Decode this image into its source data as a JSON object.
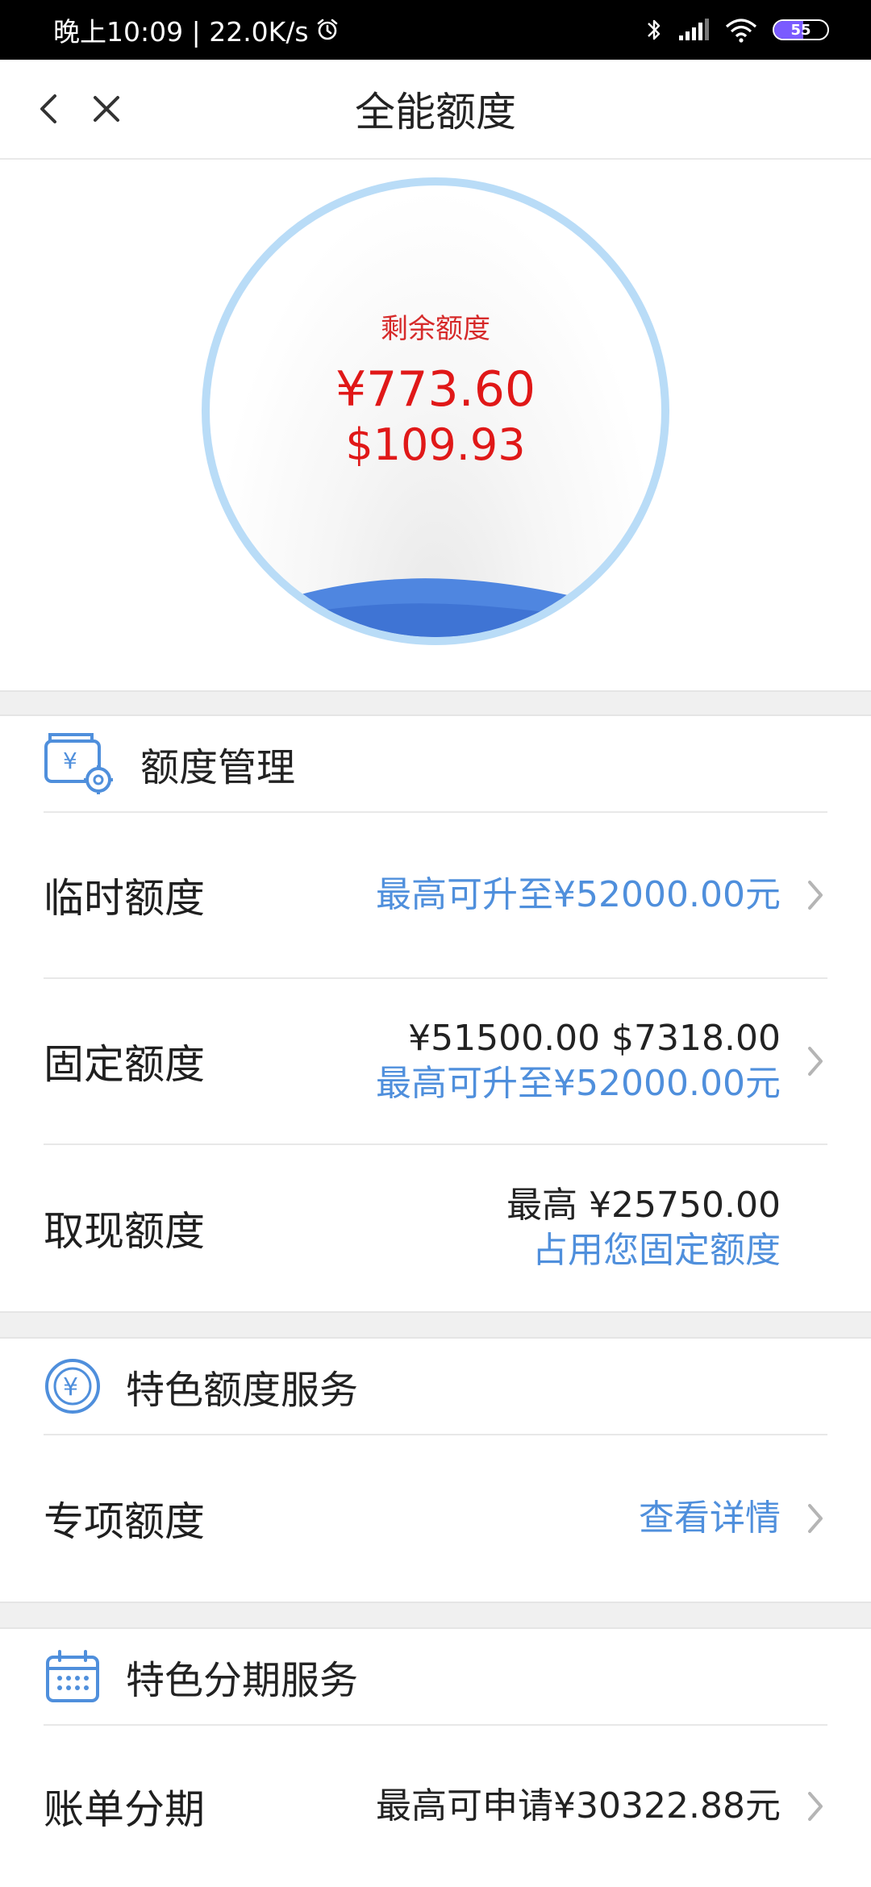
{
  "status_bar": {
    "time_speed": "晚上10:09 | 22.0K/s",
    "battery_percent": "55",
    "battery_level": 0.55,
    "icons": [
      "alarm-icon",
      "bluetooth-icon",
      "signal-icon",
      "wifi-icon",
      "battery-icon"
    ]
  },
  "header": {
    "title": "全能额度",
    "back_icon": "back-chevron-icon",
    "close_icon": "close-icon"
  },
  "hero": {
    "label": "剩余额度",
    "amount_cny": "¥773.60",
    "amount_usd": "$109.93"
  },
  "limit_management": {
    "title": "额度管理",
    "icon": "wallet-yen-gear-icon",
    "rows": [
      {
        "label": "临时额度",
        "value_blue": "最高可升至¥52000.00元",
        "has_arrow": true
      },
      {
        "label": "固定额度",
        "value_main": "¥51500.00 $7318.00",
        "value_blue": "最高可升至¥52000.00元",
        "has_arrow": true
      },
      {
        "label": "取现额度",
        "value_main": "最高 ¥25750.00",
        "value_blue": "占用您固定额度",
        "has_arrow": false
      }
    ]
  },
  "special_limit_service": {
    "title": "特色额度服务",
    "icon": "yen-coin-icon",
    "rows": [
      {
        "label": "专项额度",
        "value_blue": "查看详情",
        "has_arrow": true
      }
    ]
  },
  "special_installment_service": {
    "title": "特色分期服务",
    "icon": "calendar-icon",
    "rows": [
      {
        "label": "账单分期",
        "value_main": "最高可申请¥30322.88元",
        "has_arrow": true
      }
    ]
  },
  "colors": {
    "accent_blue": "#4f8fdc",
    "amount_red": "#e01818",
    "circle_ring": "#b9dcf7"
  }
}
